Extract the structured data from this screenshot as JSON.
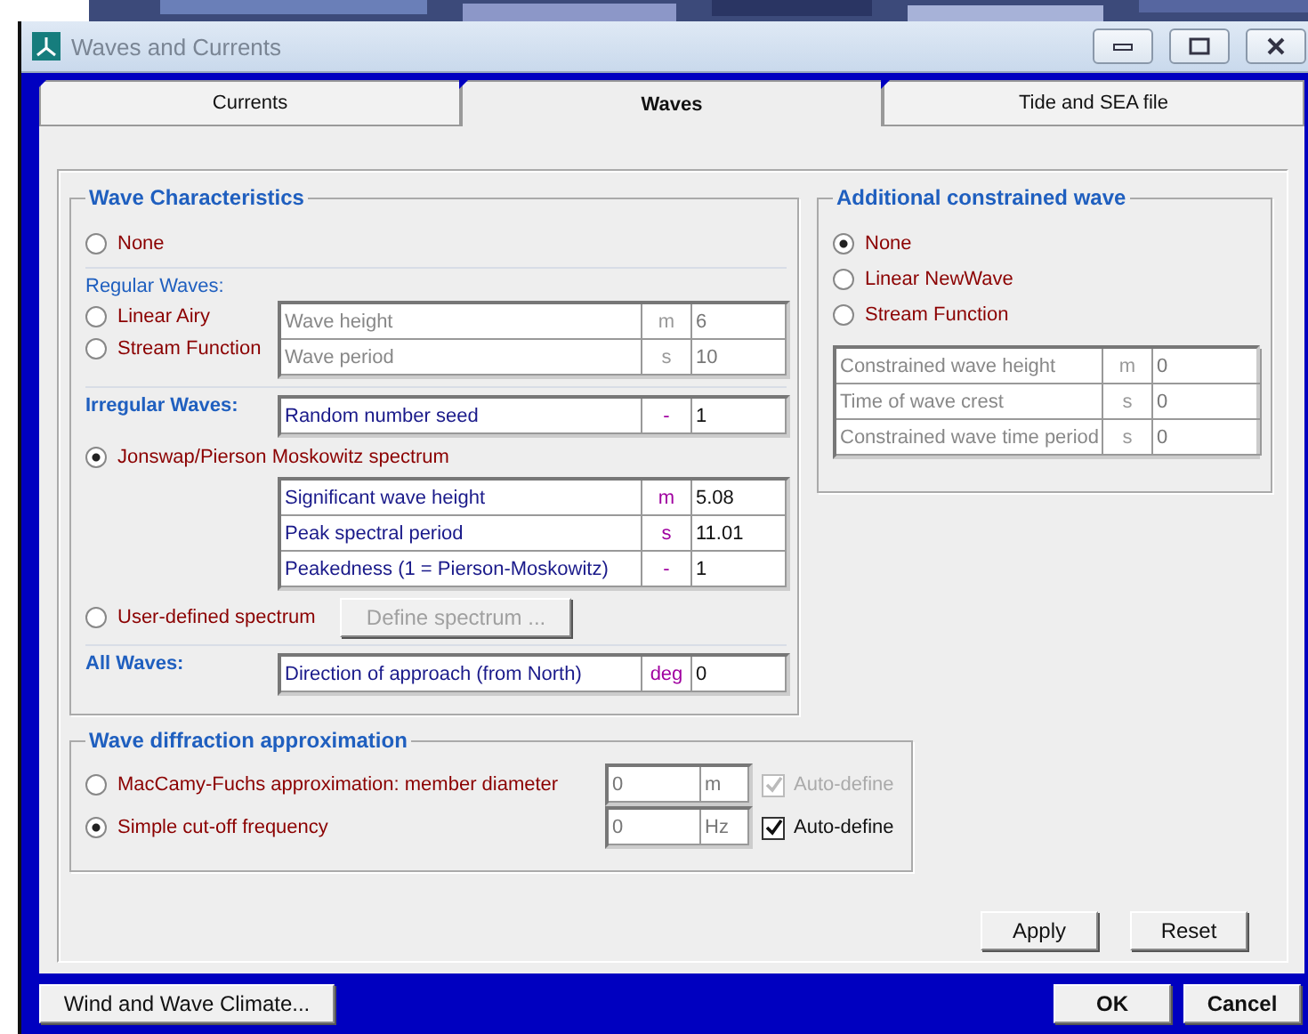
{
  "window": {
    "title": "Waves and Currents"
  },
  "tabs": [
    {
      "label": "Currents",
      "selected": false
    },
    {
      "label": "Waves",
      "selected": true
    },
    {
      "label": "Tide and SEA file",
      "selected": false
    }
  ],
  "wave_characteristics": {
    "title": "Wave Characteristics",
    "none_option": {
      "label": "None",
      "selected": false
    },
    "regular": {
      "heading": "Regular Waves:",
      "disabled": true,
      "options": [
        {
          "label": "Linear Airy",
          "selected": false
        },
        {
          "label": "Stream Function",
          "selected": false
        }
      ],
      "params": [
        {
          "label": "Wave height",
          "unit": "m",
          "value": "6"
        },
        {
          "label": "Wave period",
          "unit": "s",
          "value": "10"
        }
      ]
    },
    "irregular": {
      "heading": "Irregular Waves:",
      "disabled": false,
      "seed": [
        {
          "label": "Random number seed",
          "unit": "-",
          "value": "1"
        }
      ],
      "spectrum_option": {
        "label": "Jonswap/Pierson Moskowitz spectrum",
        "selected": true
      },
      "params": [
        {
          "label": "Significant wave height",
          "unit": "m",
          "value": "5.08"
        },
        {
          "label": "Peak spectral period",
          "unit": "s",
          "value": "11.01"
        },
        {
          "label": "Peakedness (1 = Pierson-Moskowitz)",
          "unit": "-",
          "value": "1"
        }
      ],
      "user_option": {
        "label": "User-defined spectrum",
        "selected": false
      },
      "define_button": {
        "label": "Define spectrum ...",
        "disabled": true
      }
    },
    "all_waves": {
      "heading": "All Waves:",
      "disabled": false,
      "params": [
        {
          "label": "Direction of approach (from North)",
          "unit": "deg",
          "value": "0"
        }
      ]
    }
  },
  "constrained_wave": {
    "title": "Additional constrained wave",
    "options": [
      {
        "label": "None",
        "selected": true
      },
      {
        "label": "Linear NewWave",
        "selected": false
      },
      {
        "label": "Stream Function",
        "selected": false
      }
    ],
    "disabled": true,
    "params": [
      {
        "label": "Constrained wave height",
        "unit": "m",
        "value": "0"
      },
      {
        "label": "Time of wave crest",
        "unit": "s",
        "value": "0"
      },
      {
        "label": "Constrained wave time period",
        "unit": "s",
        "value": "0"
      }
    ]
  },
  "diffraction": {
    "title": "Wave diffraction approximation",
    "options": [
      {
        "label": "MacCamy-Fuchs approximation: member diameter",
        "selected": false,
        "value": "0",
        "unit": "m",
        "auto_label": "Auto-define",
        "auto_checked": true,
        "auto_disabled": true
      },
      {
        "label": "Simple cut-off frequency",
        "selected": true,
        "value": "0",
        "unit": "Hz",
        "auto_label": "Auto-define",
        "auto_checked": true,
        "auto_disabled": false
      }
    ]
  },
  "panel_buttons": [
    "Apply",
    "Reset"
  ],
  "climate_button": "Wind and Wave Climate...",
  "dialog_buttons": [
    "OK",
    "Cancel"
  ]
}
